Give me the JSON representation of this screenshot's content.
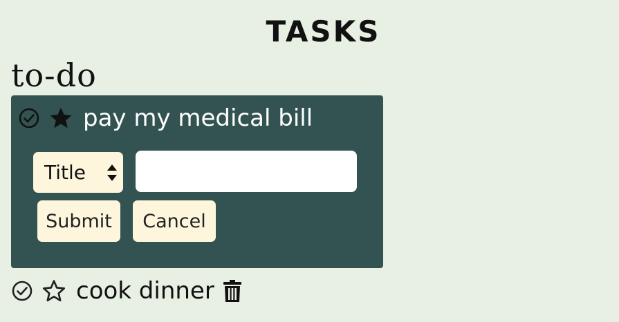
{
  "header": {
    "title": "TASKS"
  },
  "section": {
    "title": "to-do"
  },
  "tasks": [
    {
      "label": "pay my medical bill",
      "starred": true,
      "editing": true
    },
    {
      "label": "cook dinner",
      "starred": false,
      "editing": false
    }
  ],
  "edit_form": {
    "field_select": {
      "selected": "Title",
      "options": [
        "Title"
      ]
    },
    "text_input": {
      "value": "",
      "placeholder": ""
    },
    "submit_label": "Submit",
    "cancel_label": "Cancel"
  },
  "colors": {
    "background": "#e8f0e4",
    "card": "#335352",
    "button": "#fdf6dc",
    "input": "#ffffff"
  },
  "icons": [
    "check-circle-icon",
    "star-filled-icon",
    "star-outline-icon",
    "trash-icon",
    "select-arrows-icon"
  ]
}
